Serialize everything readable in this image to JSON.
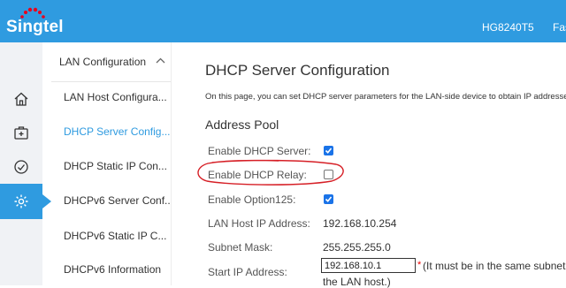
{
  "header": {
    "brand": "Singtel",
    "model": "HG8240T5",
    "right_text": "Fast",
    "bg_color": "#2f9be0",
    "logo_dot_color": "#e8001c"
  },
  "rail": {
    "items": [
      {
        "icon": "home-icon"
      },
      {
        "icon": "first-aid-icon"
      },
      {
        "icon": "speedometer-icon"
      },
      {
        "icon": "gear-icon",
        "active": true
      }
    ]
  },
  "menu": {
    "section_label": "LAN Configuration",
    "items": [
      {
        "label": "LAN Host Configura..."
      },
      {
        "label": "DHCP Server Config...",
        "active": true
      },
      {
        "label": "DHCP Static IP Con..."
      },
      {
        "label": "DHCPv6 Server Conf..."
      },
      {
        "label": "DHCPv6 Static IP C..."
      },
      {
        "label": "DHCPv6 Information"
      }
    ]
  },
  "main": {
    "title": "DHCP Server Configuration",
    "description": "On this page, you can set DHCP server parameters for the LAN-side device to obtain IP addresse",
    "section_title": "Address Pool",
    "fields": {
      "enable_dhcp_server": {
        "label": "Enable DHCP Server:",
        "checked": true
      },
      "enable_dhcp_relay": {
        "label": "Enable DHCP Relay:",
        "checked": false
      },
      "enable_option125": {
        "label": "Enable Option125:",
        "checked": true
      },
      "lan_host_ip": {
        "label": "LAN Host IP Address:",
        "value": "192.168.10.254"
      },
      "subnet_mask": {
        "label": "Subnet Mask:",
        "value": "255.255.255.0"
      },
      "start_ip": {
        "label": "Start IP Address:",
        "value": "192.168.10.1",
        "required_mark": "*",
        "hint_line1": "(It must be in the same subnet",
        "hint_line2": "the LAN host.)"
      }
    },
    "annotation_color": "#d61f26"
  }
}
